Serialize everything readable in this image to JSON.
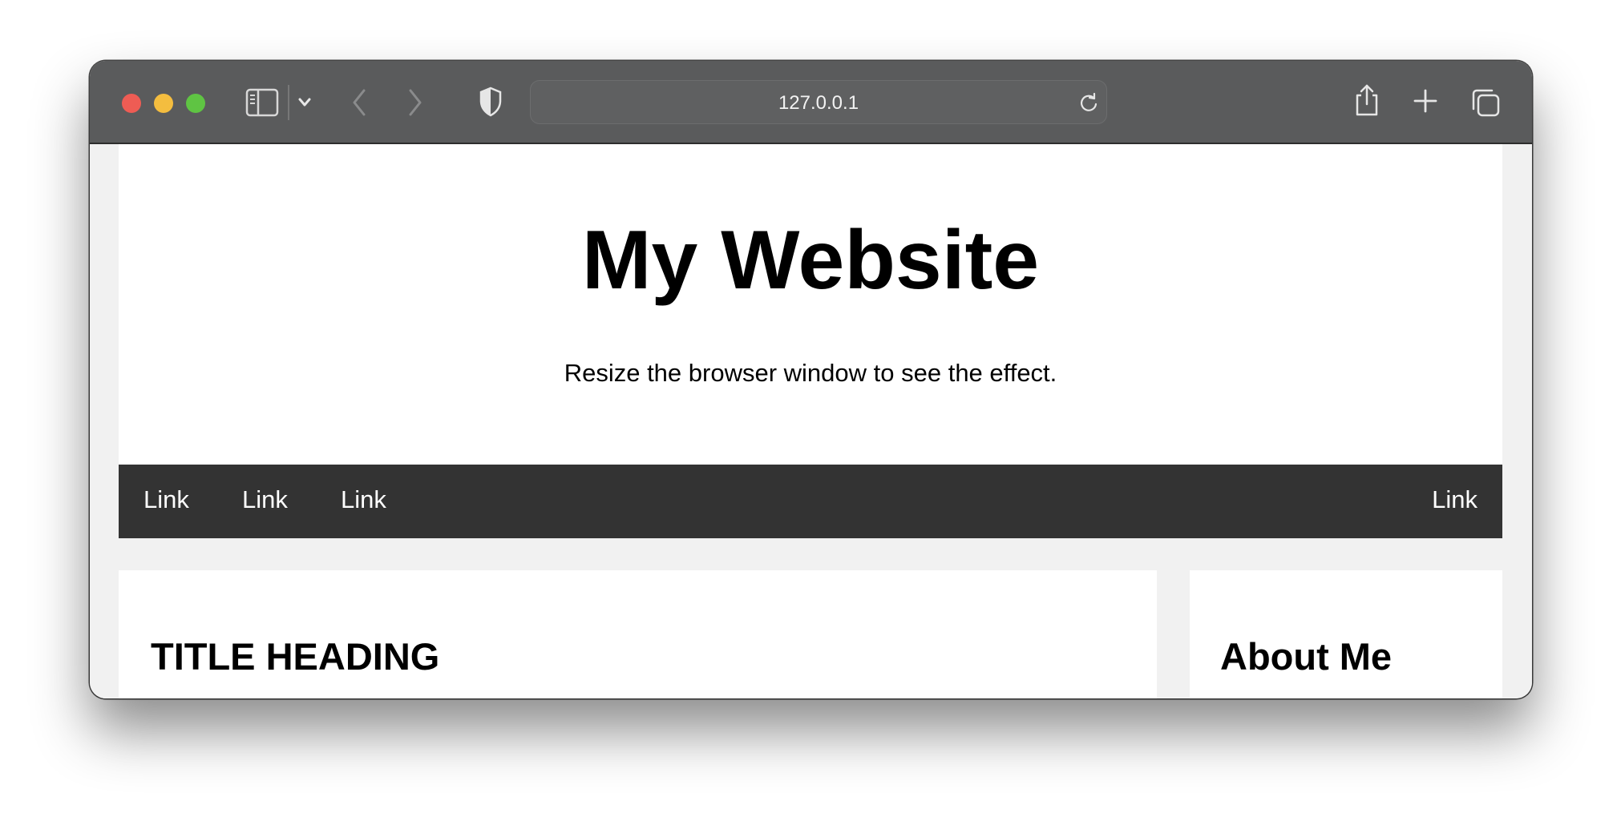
{
  "browser": {
    "address": "127.0.0.1",
    "icons": [
      "sidebar-icon",
      "chevron-down-icon",
      "back-icon",
      "forward-icon",
      "privacy-shield-icon",
      "reload-icon",
      "share-icon",
      "new-tab-icon",
      "tabs-overview-icon"
    ]
  },
  "page": {
    "header": {
      "title": "My Website",
      "subtitle": "Resize the browser window to see the effect."
    },
    "nav": {
      "links": [
        "Link",
        "Link",
        "Link"
      ],
      "right_link": "Link"
    },
    "main": {
      "heading": "TITLE HEADING"
    },
    "side": {
      "heading": "About Me"
    }
  }
}
